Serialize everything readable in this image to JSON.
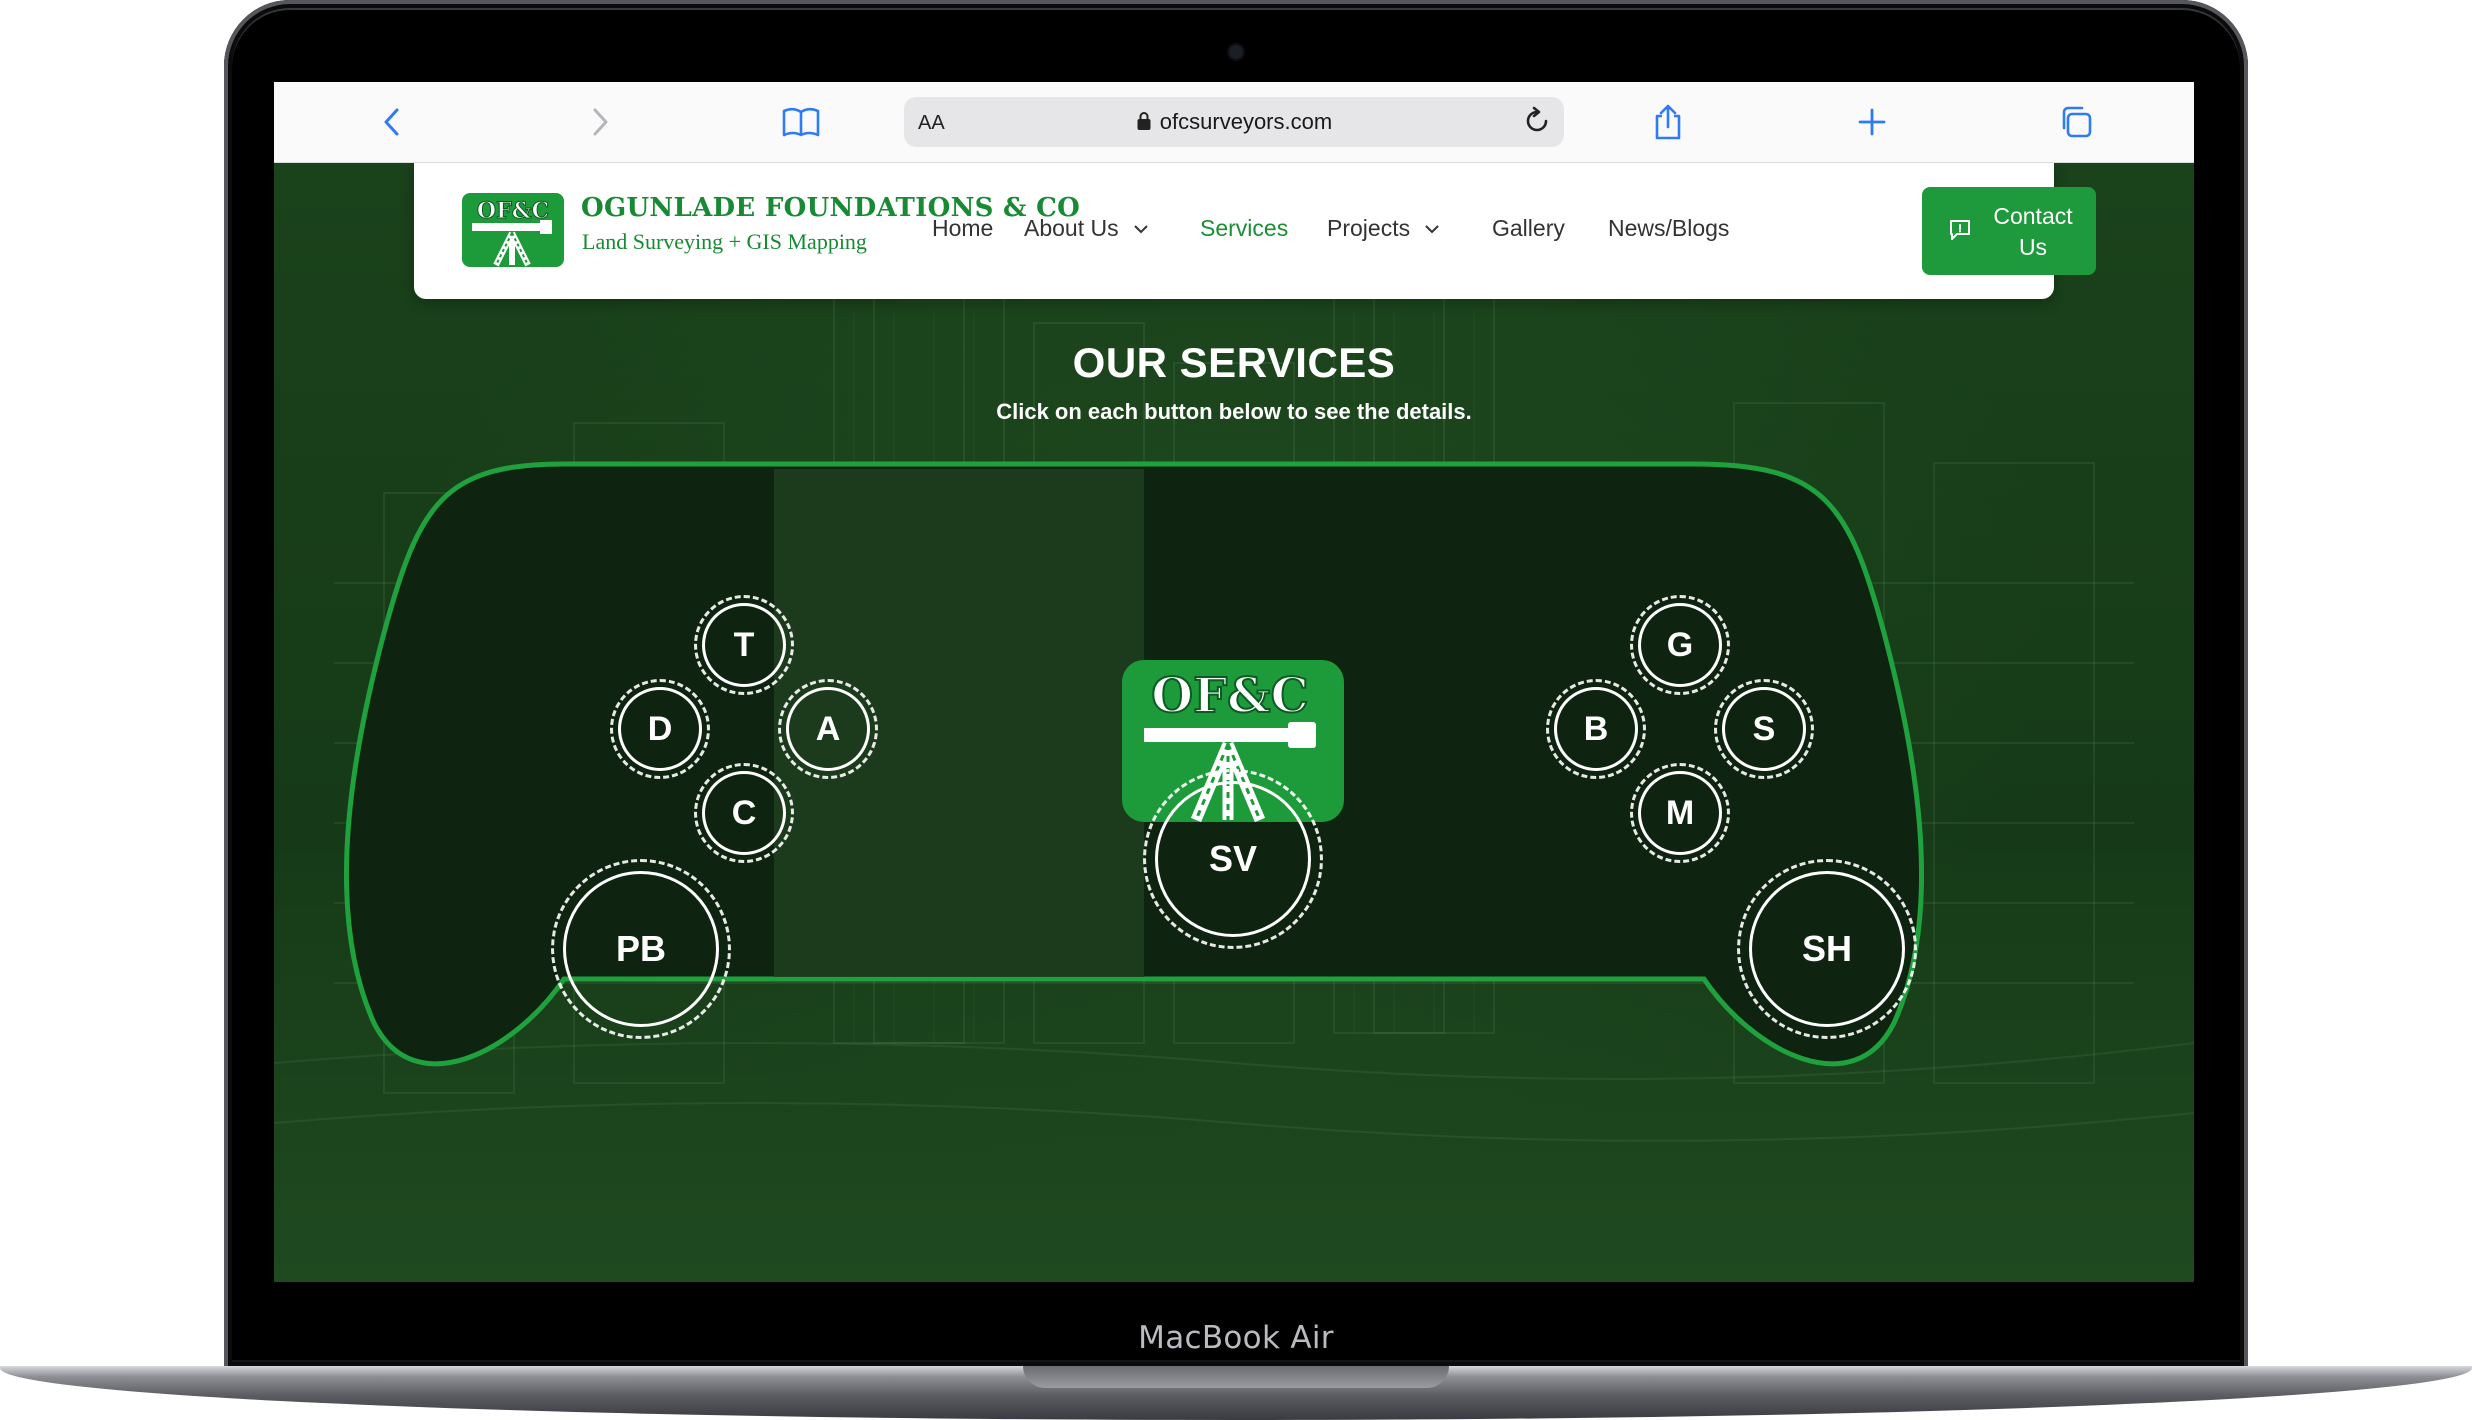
{
  "device": {
    "label": "MacBook Air"
  },
  "browser": {
    "text_size_label": "AA",
    "url": "ofcsurveyors.com"
  },
  "site": {
    "logo_text": "OF&C",
    "company_name": "OGUNLADE FOUNDATIONS & CO",
    "tagline": "Land Surveying + GIS Mapping",
    "nav": {
      "home": "Home",
      "about": "About Us",
      "services": "Services",
      "projects": "Projects",
      "gallery": "Gallery",
      "news": "News/Blogs"
    },
    "contact": {
      "line1": "Contact",
      "line2": "Us"
    },
    "accent_color": "#1e9a3c"
  },
  "services": {
    "title": "OUR SERVICES",
    "subtitle": "Click on each button below to see the details.",
    "left_buttons": {
      "top": "T",
      "left": "D",
      "right": "A",
      "bottom": "C"
    },
    "right_buttons": {
      "top": "G",
      "left": "B",
      "right": "S",
      "bottom": "M"
    },
    "big_left": "PB",
    "big_center": "SV",
    "big_right": "SH",
    "center_logo_text": "OF&C"
  }
}
